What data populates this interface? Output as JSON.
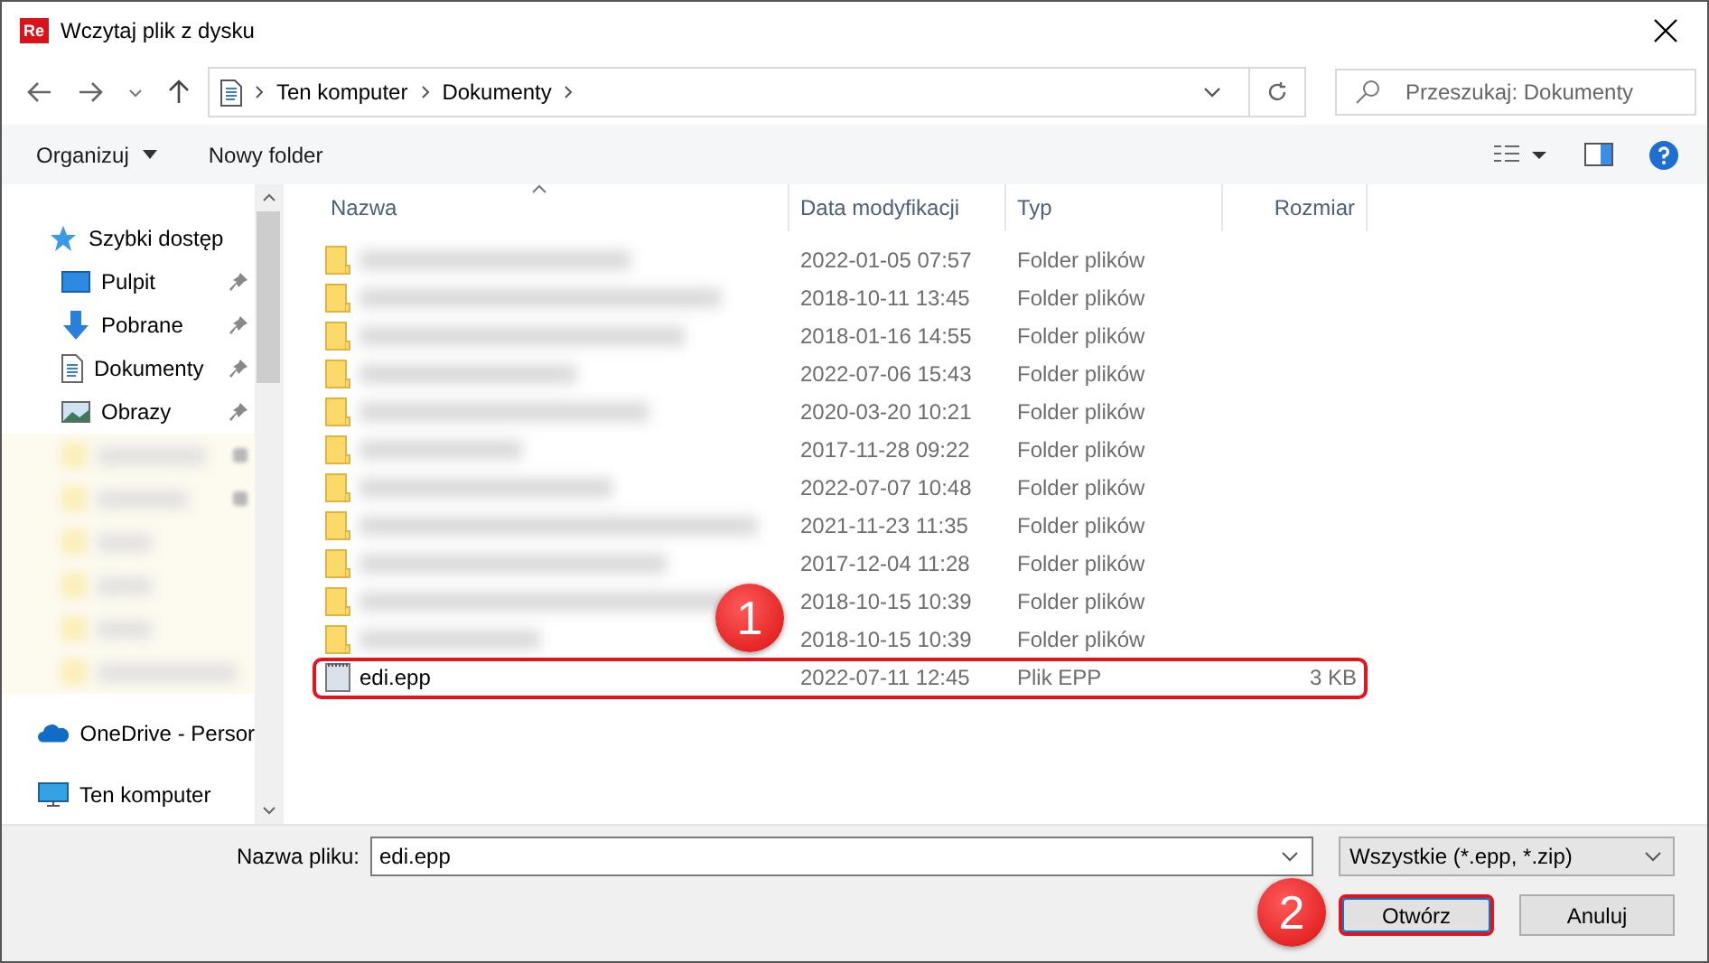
{
  "window": {
    "title": "Wczytaj plik z dysku",
    "app_badge": "Re"
  },
  "address": {
    "crumbs": [
      "Ten komputer",
      "Dokumenty"
    ]
  },
  "search": {
    "placeholder": "Przeszukaj: Dokumenty"
  },
  "toolbar": {
    "organize": "Organizuj",
    "new_folder": "Nowy folder"
  },
  "sidebar": {
    "items": [
      {
        "kind": "quick",
        "label": "Szybki dostęp",
        "children": [
          {
            "kind": "desktop",
            "label": "Pulpit",
            "pinned": true
          },
          {
            "kind": "download",
            "label": "Pobrane",
            "pinned": true
          },
          {
            "kind": "document",
            "label": "Dokumenty",
            "pinned": true
          },
          {
            "kind": "image",
            "label": "Obrazy",
            "pinned": true
          },
          {
            "kind": "blurred",
            "pinned": true
          },
          {
            "kind": "blurred",
            "pinned": true
          },
          {
            "kind": "blurred",
            "pinned": false
          },
          {
            "kind": "blurred",
            "pinned": false
          },
          {
            "kind": "blurred",
            "pinned": false
          },
          {
            "kind": "blurred",
            "pinned": false
          }
        ]
      },
      {
        "kind": "cloud",
        "label": "OneDrive - Persor"
      },
      {
        "kind": "computer",
        "label": "Ten komputer"
      }
    ]
  },
  "table": {
    "columns": [
      "Nazwa",
      "Data modyfikacji",
      "Typ",
      "Rozmiar"
    ],
    "rows": [
      {
        "kind": "folder",
        "modified": "2022-01-05 07:57",
        "type": "Folder plików"
      },
      {
        "kind": "folder",
        "modified": "2018-10-11 13:45",
        "type": "Folder plików"
      },
      {
        "kind": "folder",
        "modified": "2018-01-16 14:55",
        "type": "Folder plików"
      },
      {
        "kind": "folder",
        "modified": "2022-07-06 15:43",
        "type": "Folder plików"
      },
      {
        "kind": "folder",
        "modified": "2020-03-20 10:21",
        "type": "Folder plików"
      },
      {
        "kind": "folder",
        "modified": "2017-11-28 09:22",
        "type": "Folder plików"
      },
      {
        "kind": "folder",
        "modified": "2022-07-07 10:48",
        "type": "Folder plików"
      },
      {
        "kind": "folder",
        "modified": "2021-11-23 11:35",
        "type": "Folder plików"
      },
      {
        "kind": "folder",
        "modified": "2017-12-04 11:28",
        "type": "Folder plików"
      },
      {
        "kind": "folder",
        "modified": "2018-10-15 10:39",
        "type": "Folder plików"
      },
      {
        "kind": "folder",
        "modified": "2018-10-15 10:39",
        "type": "Folder plików"
      },
      {
        "kind": "file",
        "name": "edi.epp",
        "modified": "2022-07-11 12:45",
        "type": "Plik EPP",
        "size": "3 KB",
        "highlighted": true
      }
    ]
  },
  "footer": {
    "filename_label": "Nazwa pliku:",
    "filename": "edi.epp",
    "filter": "Wszystkie (*.epp, *.zip)",
    "buttons": [
      {
        "label": "Otwórz",
        "highlighted": true
      },
      {
        "label": "Anuluj",
        "highlighted": false
      }
    ]
  },
  "callouts": [
    {
      "label": "1"
    },
    {
      "label": "2"
    }
  ]
}
